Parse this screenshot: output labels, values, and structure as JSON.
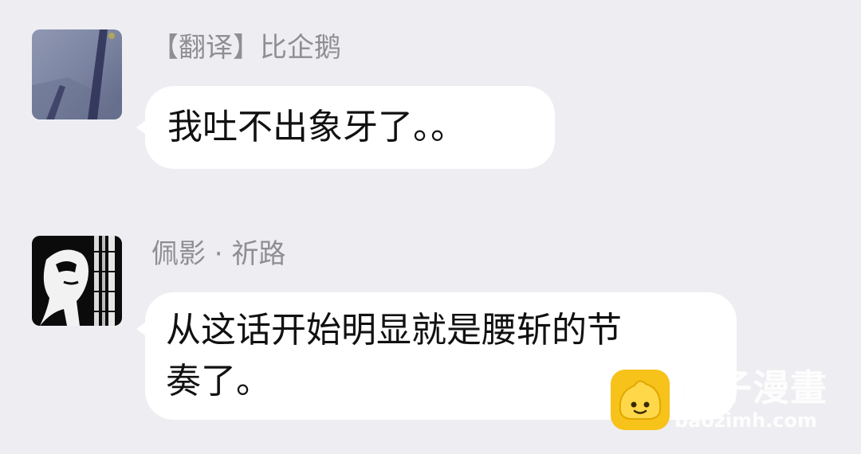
{
  "messages": [
    {
      "sender": "【翻译】比企鹅",
      "text": "我吐不出象牙了。。",
      "avatar": "photo-avatar-shadow-street"
    },
    {
      "sender": "佩影 · 祈路",
      "text": "从这话开始明显就是腰斩的节\n奏了。",
      "avatar": "photo-avatar-bw-portrait"
    }
  ],
  "watermark": {
    "title": "包子漫畫",
    "domain": "baozimh.com",
    "logo": "bun-mascot-logo"
  },
  "colors": {
    "background": "#EEEEF2",
    "bubble": "#FFFFFF",
    "sender_text": "#8E8E93",
    "message_text": "#111111",
    "logo_yellow": "#F7C21A"
  }
}
